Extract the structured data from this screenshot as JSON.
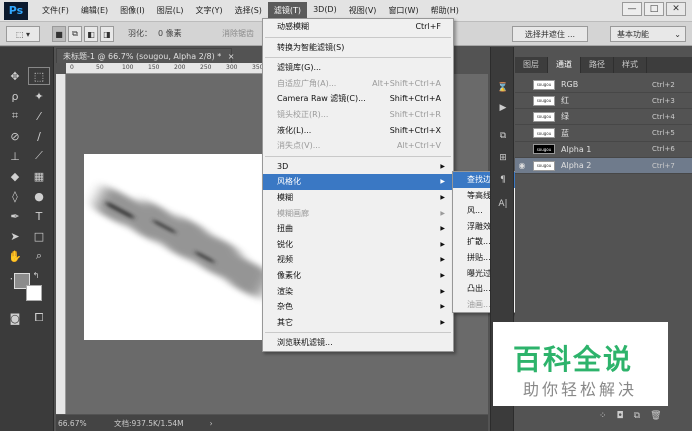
{
  "app": {
    "logo": "Ps"
  },
  "menubar": {
    "items": [
      "文件(F)",
      "编辑(E)",
      "图像(I)",
      "图层(L)",
      "文字(Y)",
      "选择(S)",
      "滤镜(T)",
      "3D(D)",
      "视图(V)",
      "窗口(W)",
      "帮助(H)"
    ],
    "active_index": 6
  },
  "window_controls": {
    "minimize": "—",
    "maximize": "□",
    "close": "✕"
  },
  "options_bar": {
    "feather_label": "羽化：",
    "feather_value": "0 像素",
    "antialias": "消除锯齿",
    "select_mask": "选择并遮住 ...",
    "workspace": "基本功能"
  },
  "document": {
    "tab_title": "未标题-1 @ 66.7% (sougou, Alpha 2/8) *",
    "close": "×",
    "zoom": "66.67%",
    "doc_info": "文档:937.5K/1.54M",
    "ruler_marks": [
      "0",
      "50",
      "100",
      "150",
      "200",
      "250",
      "300",
      "350"
    ]
  },
  "filter_menu": {
    "items": [
      {
        "label": "动感模糊",
        "shortcut": "Ctrl+F",
        "disabled": false
      },
      {
        "sep": true
      },
      {
        "label": "转换为智能滤镜(S)",
        "shortcut": "",
        "disabled": false
      },
      {
        "sep": true
      },
      {
        "label": "滤镜库(G)...",
        "shortcut": "",
        "disabled": false
      },
      {
        "label": "自适应广角(A)...",
        "shortcut": "Alt+Shift+Ctrl+A",
        "disabled": true
      },
      {
        "label": "Camera Raw 滤镜(C)...",
        "shortcut": "Shift+Ctrl+A",
        "disabled": false
      },
      {
        "label": "镜头校正(R)...",
        "shortcut": "Shift+Ctrl+R",
        "disabled": true
      },
      {
        "label": "液化(L)...",
        "shortcut": "Shift+Ctrl+X",
        "disabled": false
      },
      {
        "label": "消失点(V)...",
        "shortcut": "Alt+Ctrl+V",
        "disabled": true
      },
      {
        "sep": true
      },
      {
        "label": "3D",
        "arrow": true
      },
      {
        "label": "风格化",
        "arrow": true,
        "selected": true
      },
      {
        "label": "模糊",
        "arrow": true
      },
      {
        "label": "模糊画廊",
        "arrow": true,
        "disabled": true
      },
      {
        "label": "扭曲",
        "arrow": true
      },
      {
        "label": "锐化",
        "arrow": true
      },
      {
        "label": "视频",
        "arrow": true
      },
      {
        "label": "像素化",
        "arrow": true
      },
      {
        "label": "渲染",
        "arrow": true
      },
      {
        "label": "杂色",
        "arrow": true
      },
      {
        "label": "其它",
        "arrow": true
      },
      {
        "sep": true
      },
      {
        "label": "浏览联机滤镜..."
      }
    ]
  },
  "stylize_submenu": {
    "items": [
      {
        "label": "查找边缘",
        "selected": true
      },
      {
        "label": "等高线..."
      },
      {
        "label": "风..."
      },
      {
        "label": "浮雕效果..."
      },
      {
        "label": "扩散..."
      },
      {
        "label": "拼贴..."
      },
      {
        "label": "曝光过度"
      },
      {
        "label": "凸出..."
      },
      {
        "label": "油画...",
        "disabled": true
      }
    ]
  },
  "channels_panel": {
    "tabs": [
      "图层",
      "通道",
      "路径",
      "样式"
    ],
    "active_tab": 1,
    "rows": [
      {
        "name": "RGB",
        "shortcut": "Ctrl+2",
        "thumb": "sougou"
      },
      {
        "name": "红",
        "shortcut": "Ctrl+3",
        "thumb": "sougou"
      },
      {
        "name": "绿",
        "shortcut": "Ctrl+4",
        "thumb": "sougou"
      },
      {
        "name": "蓝",
        "shortcut": "Ctrl+5",
        "thumb": "sougou"
      },
      {
        "name": "Alpha 1",
        "shortcut": "Ctrl+6",
        "thumb": "sougou"
      },
      {
        "name": "Alpha 2",
        "shortcut": "Ctrl+7",
        "thumb": "sougou",
        "selected": true
      }
    ]
  },
  "watermark": {
    "title": "百科全说",
    "subtitle": "助你轻松解决"
  }
}
